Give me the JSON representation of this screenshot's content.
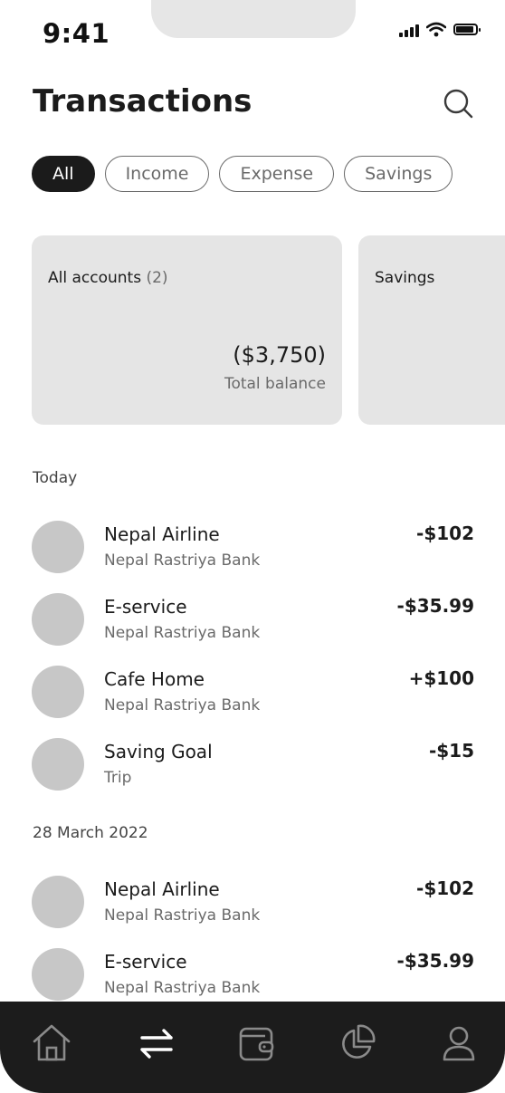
{
  "status_bar": {
    "time": "9:41"
  },
  "header": {
    "title": "Transactions",
    "search_icon": "search-icon"
  },
  "filters": [
    {
      "label": "All",
      "active": true
    },
    {
      "label": "Income",
      "active": false
    },
    {
      "label": "Expense",
      "active": false
    },
    {
      "label": "Savings",
      "active": false
    }
  ],
  "cards": [
    {
      "title": "All accounts",
      "count": "(2)",
      "amount": "($3,750)",
      "subtitle": "Total balance"
    },
    {
      "title": "Savings"
    }
  ],
  "sections": [
    {
      "label": "Today",
      "transactions": [
        {
          "name": "Nepal Airline",
          "account": "Nepal Rastriya Bank",
          "amount": "-$102"
        },
        {
          "name": "E-service",
          "account": "Nepal Rastriya Bank",
          "amount": "-$35.99"
        },
        {
          "name": "Cafe Home",
          "account": "Nepal Rastriya Bank",
          "amount": "+$100"
        },
        {
          "name": "Saving Goal",
          "account": "Trip",
          "amount": "-$15"
        }
      ]
    },
    {
      "label": "28 March 2022",
      "transactions": [
        {
          "name": "Nepal Airline",
          "account": "Nepal Rastriya Bank",
          "amount": "-$102"
        },
        {
          "name": "E-service",
          "account": "Nepal Rastriya Bank",
          "amount": "-$35.99"
        }
      ]
    }
  ],
  "bottom_nav": [
    {
      "icon": "home-icon",
      "active": false
    },
    {
      "icon": "transfer-icon",
      "active": true
    },
    {
      "icon": "wallet-icon",
      "active": false
    },
    {
      "icon": "pie-chart-icon",
      "active": false
    },
    {
      "icon": "profile-icon",
      "active": false
    }
  ],
  "colors": {
    "dark": "#1b1b1b",
    "muted": "#6a6a6a",
    "card": "#e5e5e5",
    "avatar": "#c7c7c7",
    "nav_icon": "#8a8a8a"
  }
}
